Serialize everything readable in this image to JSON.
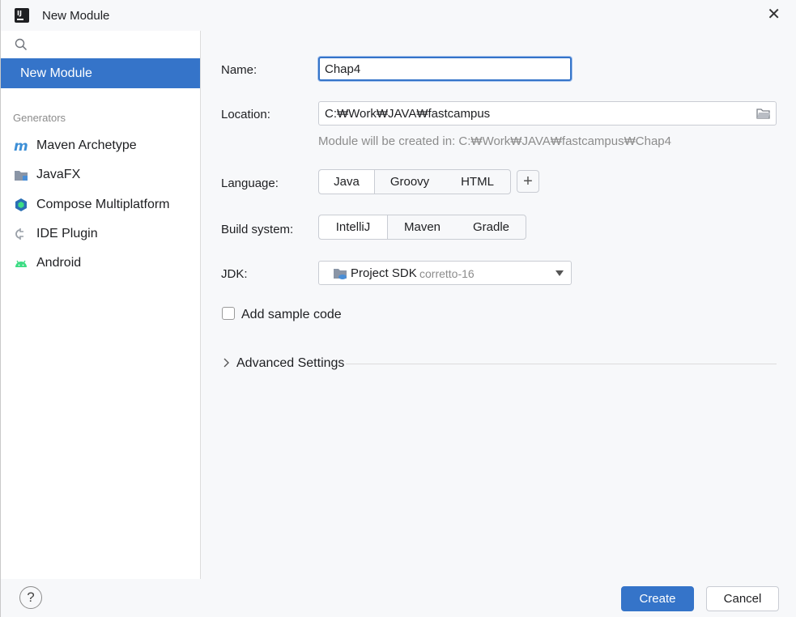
{
  "window": {
    "title": "New Module",
    "close_icon": "close-icon"
  },
  "sidebar": {
    "search_placeholder": "",
    "selected_item": "New Module",
    "section_label": "Generators",
    "generators": [
      {
        "label": "Maven Archetype",
        "icon": "maven-icon"
      },
      {
        "label": "JavaFX",
        "icon": "javafx-folder-icon"
      },
      {
        "label": "Compose Multiplatform",
        "icon": "compose-icon"
      },
      {
        "label": "IDE Plugin",
        "icon": "plugin-icon"
      },
      {
        "label": "Android",
        "icon": "android-icon"
      }
    ]
  },
  "form": {
    "name_label": "Name:",
    "name_value": "Chap4",
    "location_label": "Location:",
    "location_value": "C:₩Work₩JAVA₩fastcampus",
    "location_hint": "Module will be created in: C:₩Work₩JAVA₩fastcampus₩Chap4",
    "language_label": "Language:",
    "languages": [
      "Java",
      "Groovy",
      "HTML"
    ],
    "selected_language": "Java",
    "build_label": "Build system:",
    "build_systems": [
      "IntelliJ",
      "Maven",
      "Gradle"
    ],
    "selected_build": "IntelliJ",
    "jdk_label": "JDK:",
    "jdk_name": "Project SDK",
    "jdk_version": "corretto-16",
    "sample_code_label": "Add sample code",
    "sample_code_checked": false,
    "advanced_label": "Advanced Settings"
  },
  "footer": {
    "help_label": "?",
    "create_label": "Create",
    "cancel_label": "Cancel"
  },
  "colors": {
    "accent": "#3574c9",
    "hint": "#8c8c8c",
    "border": "#c9ccd3"
  }
}
